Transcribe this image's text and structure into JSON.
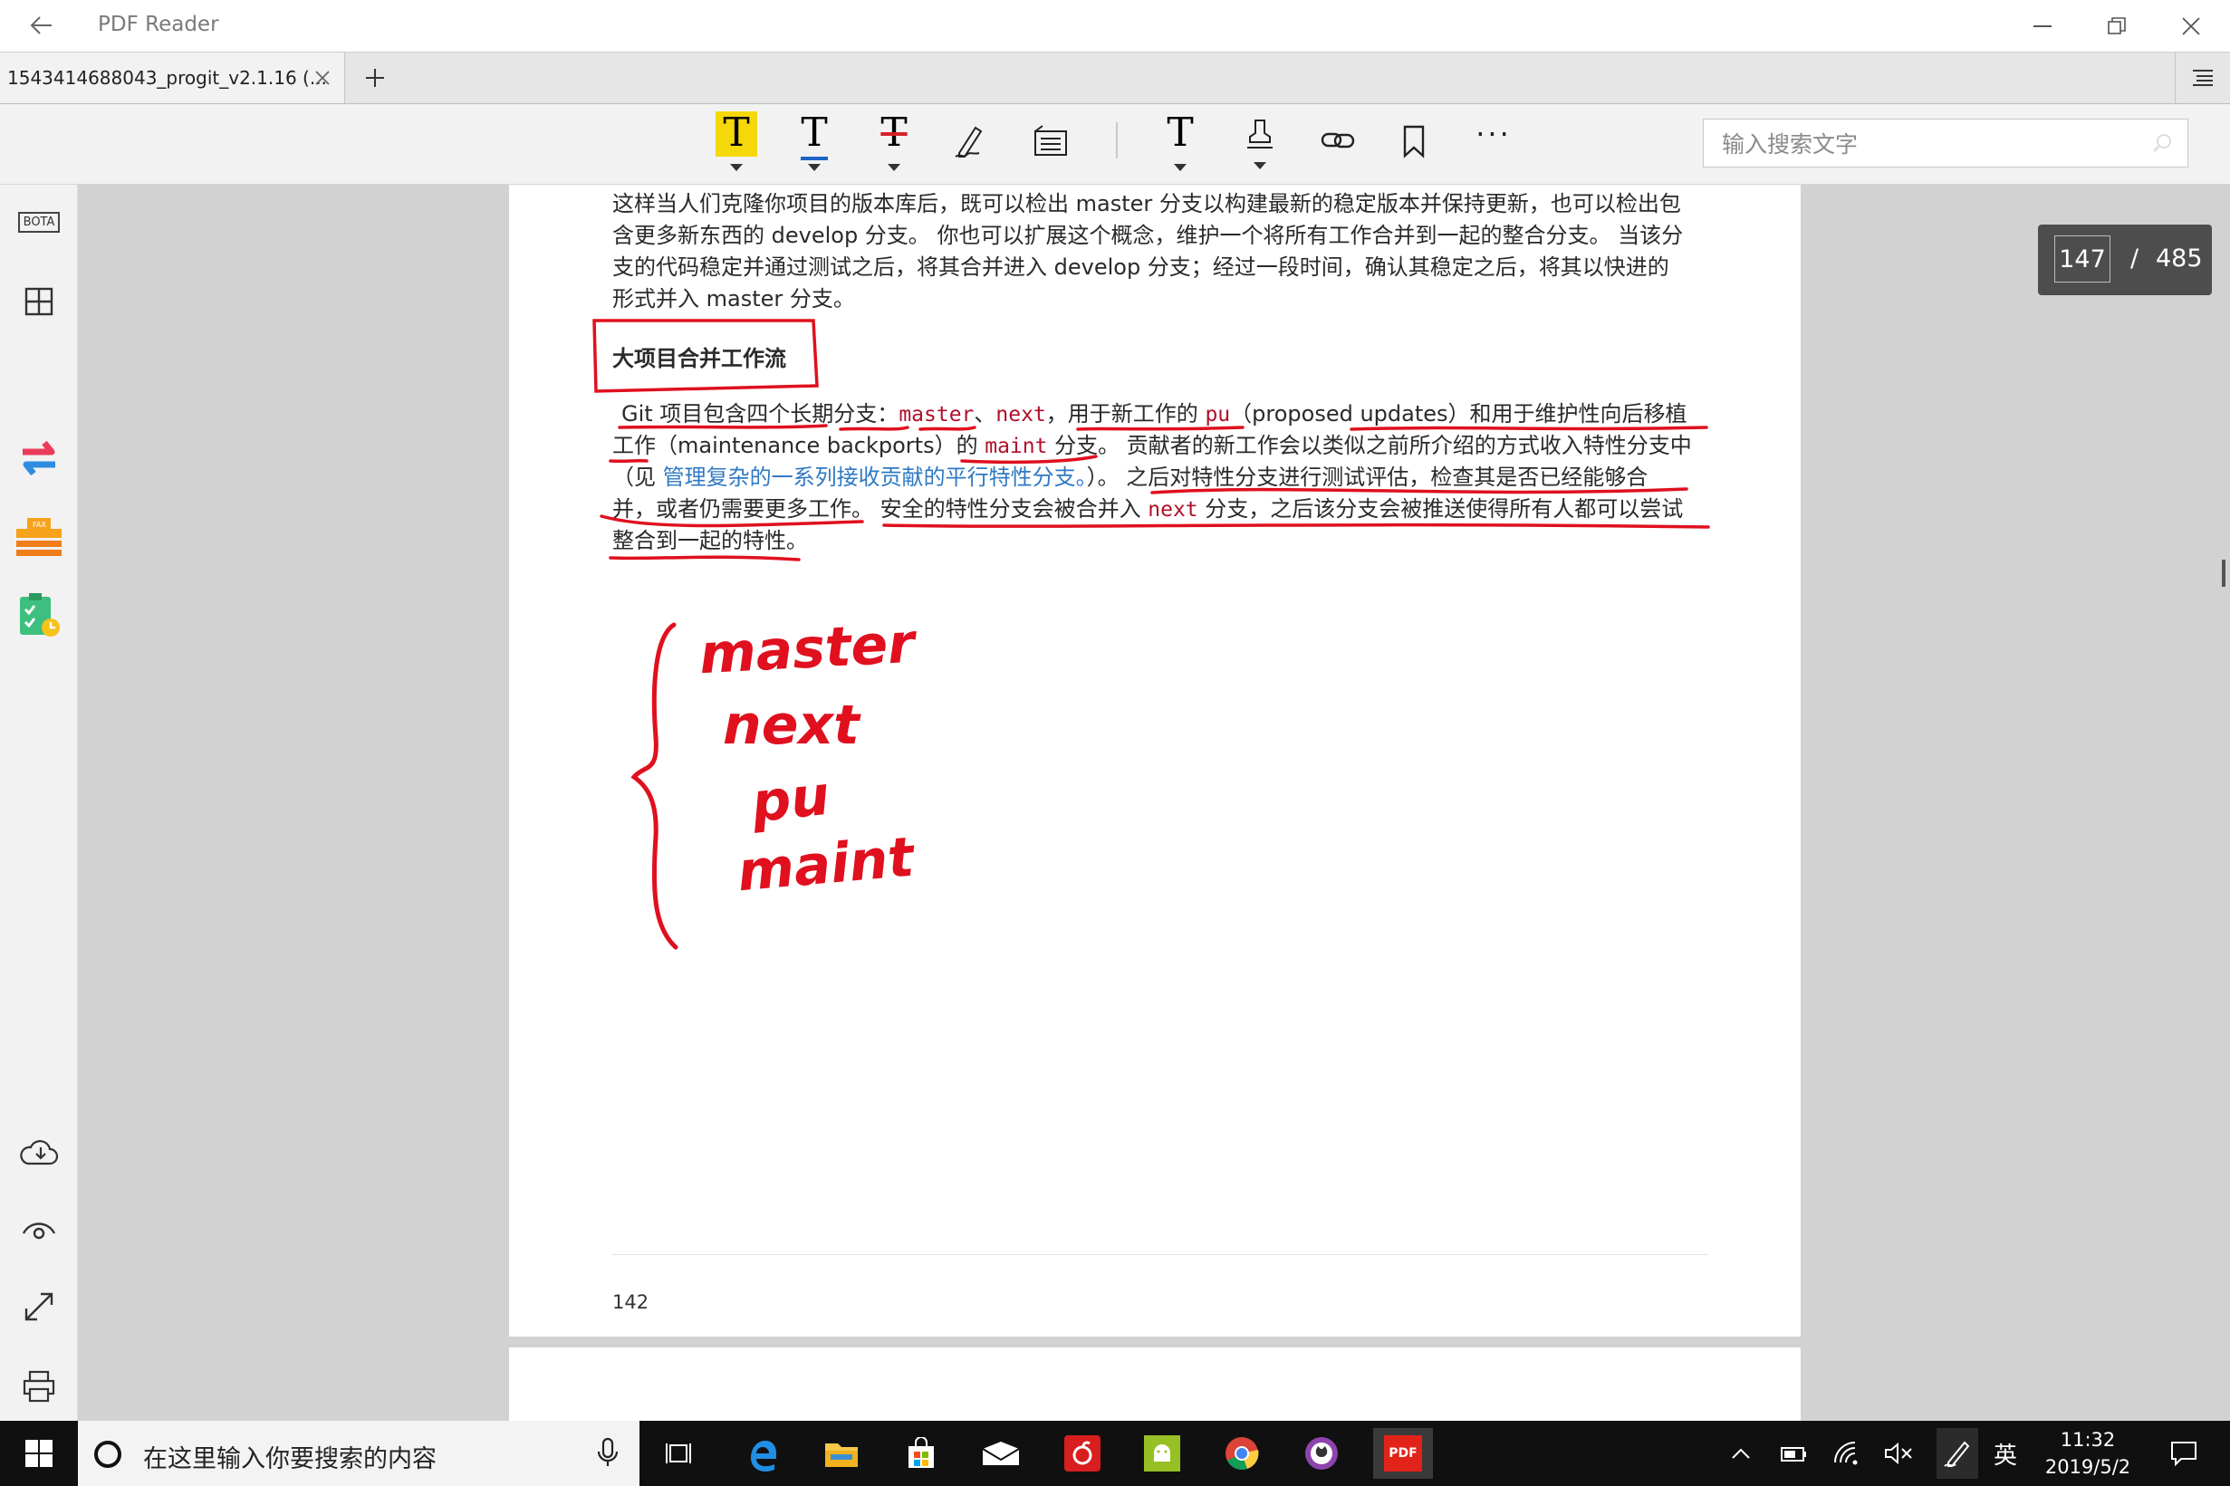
{
  "window": {
    "title": "PDF Reader",
    "back_icon": "back-arrow-icon",
    "controls": [
      "minimize-icon",
      "restore-icon",
      "close-icon"
    ]
  },
  "tabs": [
    {
      "label": "1543414688043_progit_v2.1.16 (...",
      "close_icon": "close-icon"
    }
  ],
  "toolbar": {
    "tools": [
      {
        "name": "highlight-tool",
        "glyph": "T",
        "accent": "#f5d80a",
        "has_dropdown": true
      },
      {
        "name": "underline-tool",
        "glyph": "T",
        "accent": "#1e64c8",
        "has_dropdown": true
      },
      {
        "name": "strikethrough-tool",
        "glyph": "T",
        "accent": "#d8202a",
        "has_dropdown": true
      },
      {
        "name": "pen-tool",
        "icon": "signature-pen-icon"
      },
      {
        "name": "note-tool",
        "icon": "note-icon"
      },
      {
        "name": "text-tool",
        "glyph": "T",
        "has_dropdown": true
      },
      {
        "name": "stamp-tool",
        "icon": "stamp-icon",
        "has_dropdown": true
      },
      {
        "name": "link-tool",
        "icon": "link-icon"
      },
      {
        "name": "bookmark-tool",
        "icon": "bookmark-icon"
      },
      {
        "name": "more-tool",
        "glyph": "···"
      }
    ],
    "search_placeholder": "输入搜索文字"
  },
  "sidebar": {
    "top": [
      {
        "name": "bota-button",
        "label": "BOTA"
      },
      {
        "name": "thumbnails-button",
        "icon": "grid-icon"
      },
      {
        "name": "convert-button",
        "icon": "convert-arrows-icon"
      },
      {
        "name": "fax-button",
        "icon": "fax-icon",
        "label": "FAX"
      },
      {
        "name": "tasks-button",
        "icon": "clipboard-icon"
      }
    ],
    "bottom": [
      {
        "name": "cloud-button",
        "icon": "cloud-icon"
      },
      {
        "name": "view-mode-button",
        "icon": "eye-icon"
      },
      {
        "name": "fullscreen-button",
        "icon": "expand-icon"
      },
      {
        "name": "print-button",
        "icon": "printer-icon"
      }
    ]
  },
  "document": {
    "para1": [
      "这样当人们克隆你项目的版本库后，既可以检出 master 分支以构建最新的稳定版本并保持更新，也可以检出包",
      "含更多新东西的 develop 分支。 你也可以扩展这个概念，维护一个将所有工作合并到一起的整合分支。 当该分",
      "支的代码稳定并通过测试之后，将其合并进入 develop 分支；经过一段时间，确认其稳定之后，将其以快进的",
      "形式并入 master 分支。"
    ],
    "heading": "大项目合并工作流",
    "para2": {
      "l1_a": "Git 项目包含四个长期分支：",
      "code_master": "master",
      "sep1": "、",
      "code_next": "next",
      "l1_b": "，用于新工作的 ",
      "code_pu": "pu",
      "l1_c": "（proposed updates）和用于维护性向后移植",
      "l2_a": "工作（maintenance backports）的 ",
      "code_maint": "maint",
      "l2_b": " 分支。 贡献者的新工作会以类似之前所介绍的方式收入特性分支中",
      "l3_a": "（见 ",
      "l3_link": "管理复杂的一系列接收贡献的平行特性分支。",
      "l3_b": "）。 之后对特性分支进行测试评估，检查其是否已经能够合",
      "l4_a": "并，或者仍需要更多工作。 安全的特性分支会被合并入 ",
      "l4_code": "next",
      "l4_b": " 分支，之后该分支会被推送使得所有人都可以尝试",
      "l5": "整合到一起的特性。"
    },
    "handwritten": [
      "master",
      "next",
      "pu",
      "maint"
    ],
    "page_label": "142",
    "ink_color": "#e0101e"
  },
  "page_counter": {
    "current": "147",
    "separator": "/",
    "total": "485"
  },
  "taskbar": {
    "search_placeholder": "在这里输入你要搜索的内容",
    "apps": [
      "task-view-icon",
      "edge-icon",
      "file-explorer-icon",
      "store-icon",
      "mail-icon",
      "netease-music-icon",
      "android-icon",
      "chrome-icon",
      "github-icon",
      "pdf-reader-icon"
    ],
    "pdf_app_label": "PDF",
    "tray": [
      "chevron-up-icon",
      "battery-icon",
      "wifi-icon",
      "volume-muted-icon",
      "pen-icon"
    ],
    "ime": "英",
    "time": "11:32",
    "date": "2019/5/2"
  }
}
